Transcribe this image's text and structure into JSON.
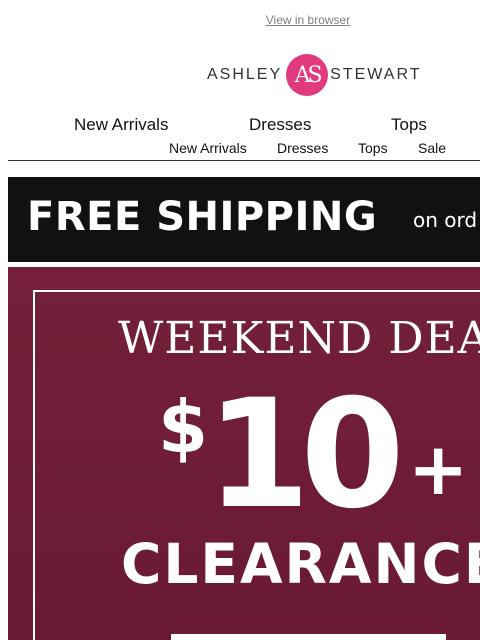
{
  "header": {
    "view_in_browser": "View in browser"
  },
  "logo": {
    "left_text": "ASHLEY",
    "monogram": "AS",
    "right_text": "STEWART",
    "brand_color": "#e23a7e"
  },
  "nav_primary": {
    "items": [
      {
        "label": "New Arrivals"
      },
      {
        "label": "Dresses"
      },
      {
        "label": "Tops"
      }
    ]
  },
  "nav_secondary": {
    "items": [
      {
        "label": "New Arrivals"
      },
      {
        "label": "Dresses"
      },
      {
        "label": "Tops"
      },
      {
        "label": "Sale"
      }
    ]
  },
  "shipping_banner": {
    "headline": "FREE SHIPPING",
    "subtext": "on ord",
    "background_color": "#111111"
  },
  "promo": {
    "title": "WEEKEND DEAL",
    "currency": "$",
    "amount": "10",
    "plus": "+",
    "label": "CLEARANCE",
    "background_color": "#6e1d36"
  }
}
